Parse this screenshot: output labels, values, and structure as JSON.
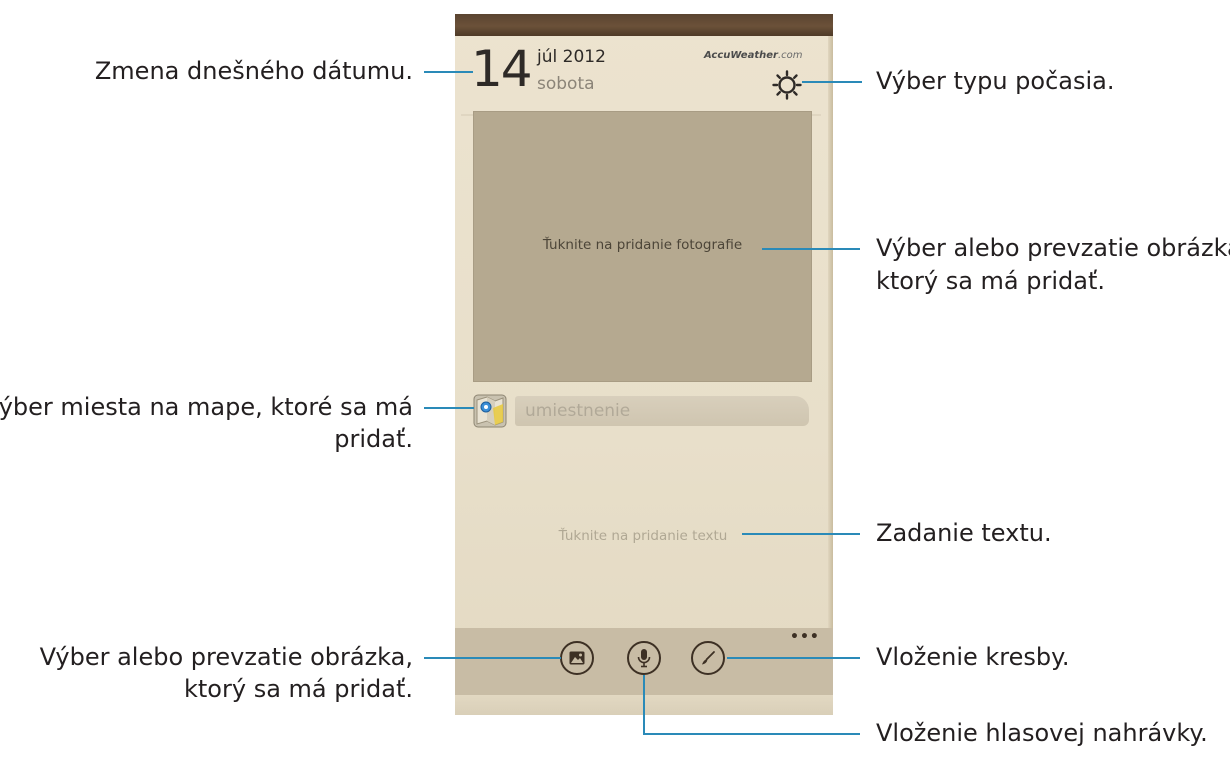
{
  "phone": {
    "date": {
      "day": "14",
      "month_year": "júl 2012",
      "weekday": "sobota"
    },
    "weather": {
      "provider": "AccuWeather",
      "provider_suffix": ".com",
      "settings_icon": "sun-gear-icon"
    },
    "photo": {
      "hint": "Ťuknite na pridanie fotografie"
    },
    "location": {
      "placeholder": "umiestnenie",
      "icon": "map-icon"
    },
    "text": {
      "hint": "Ťuknite na pridanie textu"
    },
    "toolbar": {
      "buttons": [
        {
          "icon": "image-icon"
        },
        {
          "icon": "microphone-icon"
        },
        {
          "icon": "brush-icon"
        }
      ],
      "more_label": "•••"
    },
    "colors": {
      "toolbar": "#c8bca5",
      "photo_area": "#b5a990",
      "callout_line": "#2a8ab8"
    }
  },
  "callouts": {
    "date": "Zmena dnešného dátumu.",
    "weather": "Výber typu počasia.",
    "photo_line1": "Výber alebo prevzatie obrázka,",
    "photo_line2": "ktorý sa má pridať.",
    "map_line1": "Výber miesta na mape, ktoré sa má",
    "map_line2": "pridať.",
    "text": "Zadanie textu.",
    "image_line1": "Výber alebo prevzatie obrázka,",
    "image_line2": "ktorý sa má pridať.",
    "drawing": "Vloženie kresby.",
    "voice": "Vloženie hlasovej nahrávky."
  }
}
